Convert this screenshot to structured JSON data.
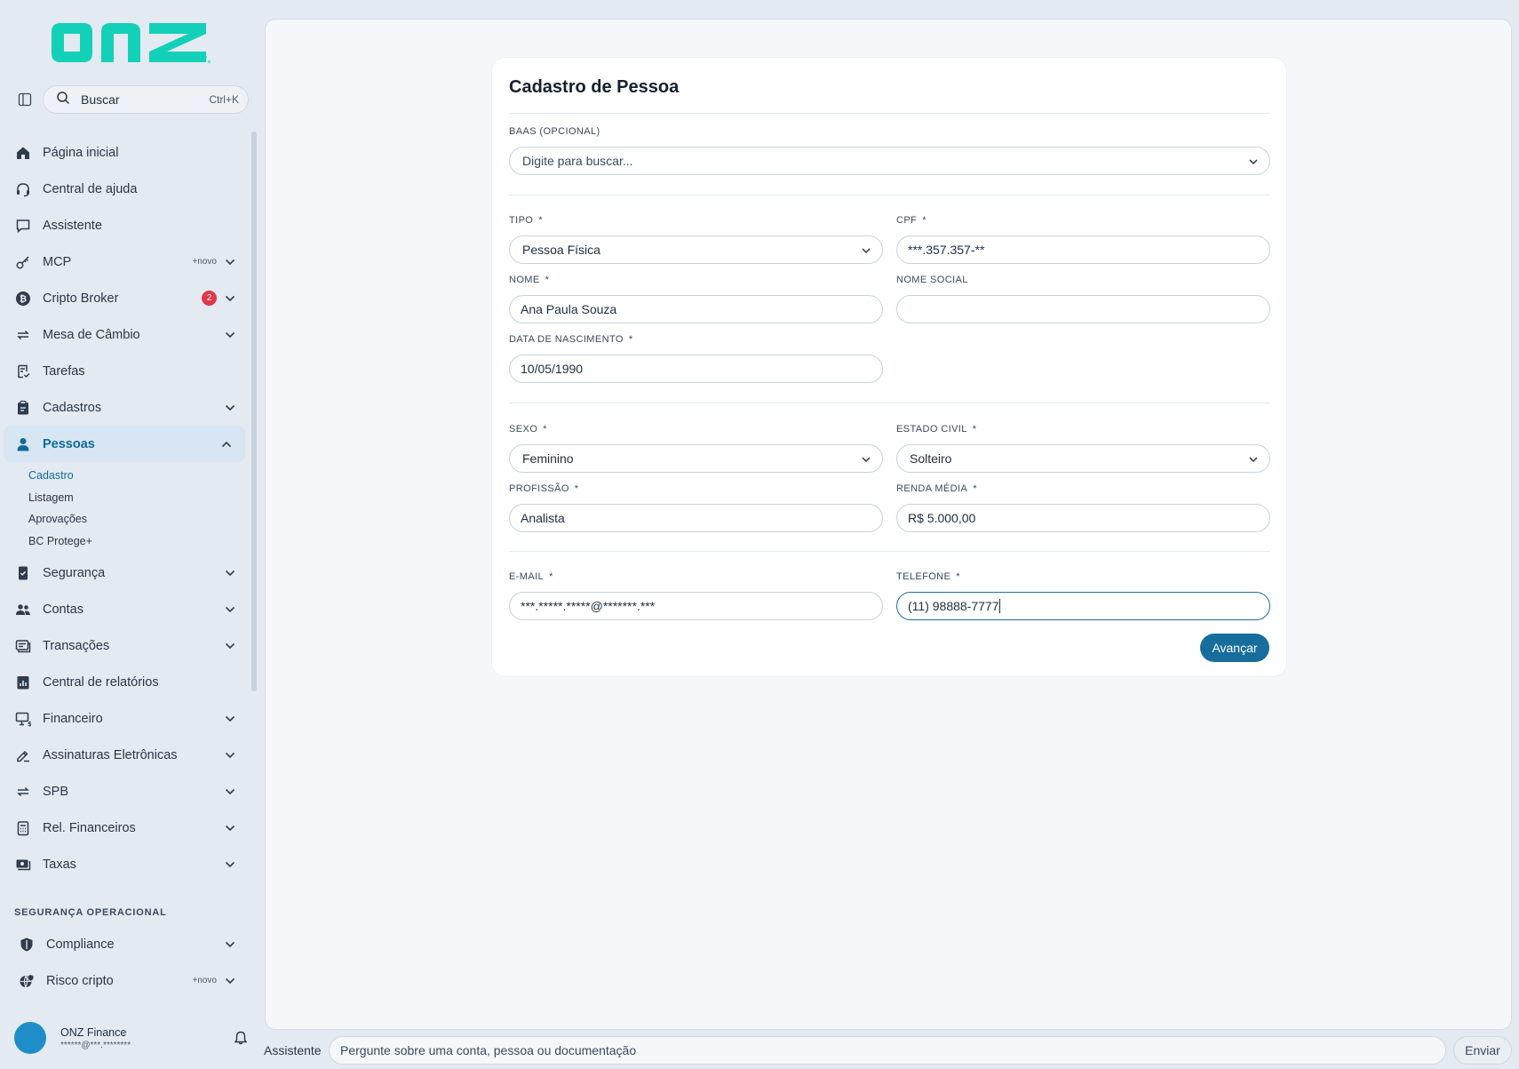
{
  "brand": {
    "logo_text": "onz",
    "accent_color": "#12d1b8"
  },
  "search": {
    "label": "Buscar",
    "shortcut": "Ctrl+K"
  },
  "sidebar": {
    "items": [
      {
        "id": "pagina-inicial",
        "label": "Página inicial",
        "icon": "home-icon",
        "novo": "",
        "badge": "",
        "chevron": ""
      },
      {
        "id": "central-ajuda",
        "label": "Central de ajuda",
        "icon": "headset-icon",
        "novo": "",
        "badge": "",
        "chevron": ""
      },
      {
        "id": "assistente",
        "label": "Assistente",
        "icon": "chat-icon",
        "novo": "",
        "badge": "",
        "chevron": ""
      },
      {
        "id": "mcp",
        "label": "MCP",
        "icon": "key-icon",
        "novo": "+novo",
        "badge": "",
        "chevron": "down"
      },
      {
        "id": "cripto-broker",
        "label": "Cripto Broker",
        "icon": "bitcoin-icon",
        "novo": "",
        "badge": "2",
        "chevron": "down"
      },
      {
        "id": "mesa-cambio",
        "label": "Mesa de Câmbio",
        "icon": "swap-icon",
        "novo": "",
        "badge": "",
        "chevron": "down"
      },
      {
        "id": "tarefas",
        "label": "Tarefas",
        "icon": "task-icon",
        "novo": "",
        "badge": "",
        "chevron": ""
      },
      {
        "id": "cadastros",
        "label": "Cadastros",
        "icon": "clipboard-icon",
        "novo": "",
        "badge": "",
        "chevron": "down"
      },
      {
        "id": "pessoas",
        "label": "Pessoas",
        "icon": "person-icon",
        "novo": "",
        "badge": "",
        "chevron": "up",
        "active": true
      }
    ],
    "pessoas_sub": [
      {
        "label": "Cadastro",
        "active": true
      },
      {
        "label": "Listagem"
      },
      {
        "label": "Aprovações"
      },
      {
        "label": "BC Protege+"
      }
    ],
    "items_after": [
      {
        "id": "seguranca",
        "label": "Segurança",
        "icon": "phone-check-icon",
        "novo": "",
        "badge": "",
        "chevron": "down"
      },
      {
        "id": "contas",
        "label": "Contas",
        "icon": "users-icon",
        "novo": "",
        "badge": "",
        "chevron": "down"
      },
      {
        "id": "transacoes",
        "label": "Transações",
        "icon": "receipt-icon",
        "novo": "",
        "badge": "",
        "chevron": "down"
      },
      {
        "id": "central-relatorios",
        "label": "Central de relatórios",
        "icon": "report-icon",
        "novo": "",
        "badge": "",
        "chevron": ""
      },
      {
        "id": "financeiro",
        "label": "Financeiro",
        "icon": "monitor-money-icon",
        "novo": "",
        "badge": "",
        "chevron": "down"
      },
      {
        "id": "assinaturas",
        "label": "Assinaturas Eletrônicas",
        "icon": "signature-icon",
        "novo": "",
        "badge": "",
        "chevron": "down"
      },
      {
        "id": "spb",
        "label": "SPB",
        "icon": "swap-icon",
        "novo": "",
        "badge": "",
        "chevron": "down"
      },
      {
        "id": "rel-financeiros",
        "label": "Rel. Financeiros",
        "icon": "calculator-icon",
        "novo": "",
        "badge": "",
        "chevron": "down"
      },
      {
        "id": "taxas",
        "label": "Taxas",
        "icon": "money-icon",
        "novo": "",
        "badge": "",
        "chevron": "down"
      }
    ],
    "section_title": "SEGURANÇA OPERACIONAL",
    "section_items": [
      {
        "id": "compliance",
        "label": "Compliance",
        "icon": "shield-icon",
        "novo": "",
        "badge": "",
        "chevron": "down"
      },
      {
        "id": "risco-cripto",
        "label": "Risco cripto",
        "icon": "globe-shield-icon",
        "novo": "+novo",
        "badge": "",
        "chevron": "down"
      }
    ]
  },
  "user": {
    "name": "ONZ Finance",
    "email": "******@***.********"
  },
  "form": {
    "title": "Cadastro de Pessoa",
    "baas": {
      "label": "BAAS (OPCIONAL)",
      "placeholder": "Digite para buscar..."
    },
    "tipo": {
      "label": "TIPO",
      "value": "Pessoa Física"
    },
    "cpf": {
      "label": "CPF",
      "value": "***.357.357-**"
    },
    "nome": {
      "label": "NOME",
      "value": "Ana Paula Souza"
    },
    "nome_social": {
      "label": "NOME SOCIAL",
      "value": ""
    },
    "data_nascimento": {
      "label": "DATA DE NASCIMENTO",
      "value": "10/05/1990"
    },
    "sexo": {
      "label": "SEXO",
      "value": "Feminino"
    },
    "estado_civil": {
      "label": "ESTADO CIVIL",
      "value": "Solteiro"
    },
    "profissao": {
      "label": "PROFISSÃO",
      "value": "Analista"
    },
    "renda_media": {
      "label": "RENDA MÉDIA",
      "value": "R$ 5.000,00"
    },
    "email": {
      "label": "E-MAIL",
      "value": "***.*****.*****@*******.***"
    },
    "telefone": {
      "label": "TELEFONE",
      "value": "(11) 98888-7777"
    },
    "required_mark": "*",
    "submit_label": "Avançar"
  },
  "assistant": {
    "label": "Assistente",
    "placeholder": "Pergunte sobre uma conta, pessoa ou documentação",
    "send_label": "Enviar"
  }
}
